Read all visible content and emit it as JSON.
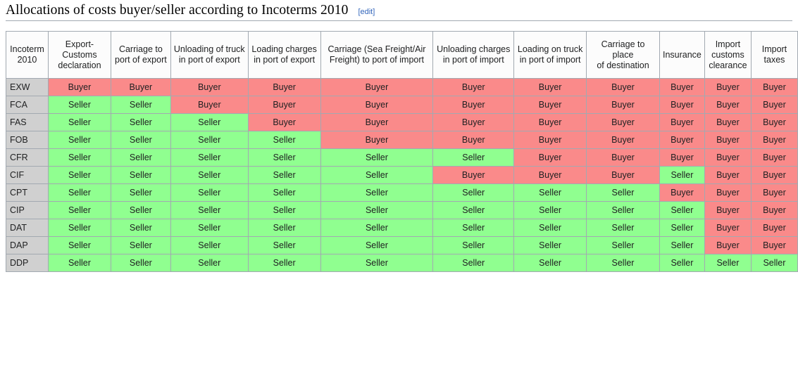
{
  "heading": {
    "title": "Allocations of costs buyer/seller according to Incoterms 2010",
    "edit_label": "[edit]"
  },
  "colors": {
    "buyer_bg": "#fa8a8a",
    "seller_bg": "#90ff90",
    "rowhead_bg": "#d0d0d0",
    "header_bg": "#fcfcfc",
    "border": "#a2a9b1",
    "link": "#3366bb"
  },
  "table": {
    "columns": [
      "Incoterm 2010",
      "Export- Customs declaration",
      "Carriage to port of export",
      "Unloading of truck in port of export",
      "Loading charges in port of export",
      "Carriage (Sea Freight/Air Freight) to port of import",
      "Unloading charges in port of import",
      "Loading on truck in port of import",
      "Carriage to place of destination",
      "Insurance",
      "Import customs clearance",
      "Import taxes"
    ],
    "column_lines": [
      [
        "Incoterm",
        "2010"
      ],
      [
        "Export-",
        "Customs",
        "declaration"
      ],
      [
        "Carriage to",
        "port of export"
      ],
      [
        "Unloading of truck",
        "in port of export"
      ],
      [
        "Loading charges",
        "in port of export"
      ],
      [
        "Carriage (Sea Freight/Air",
        "Freight) to port of import"
      ],
      [
        "Unloading charges",
        "in port of import"
      ],
      [
        "Loading on truck",
        "in port of import"
      ],
      [
        "Carriage to place",
        "of destination"
      ],
      [
        "Insurance"
      ],
      [
        "Import",
        "customs",
        "clearance"
      ],
      [
        "Import",
        "taxes"
      ]
    ],
    "rows": [
      {
        "incoterm": "EXW",
        "values": [
          "Buyer",
          "Buyer",
          "Buyer",
          "Buyer",
          "Buyer",
          "Buyer",
          "Buyer",
          "Buyer",
          "Buyer",
          "Buyer",
          "Buyer"
        ]
      },
      {
        "incoterm": "FCA",
        "values": [
          "Seller",
          "Seller",
          "Buyer",
          "Buyer",
          "Buyer",
          "Buyer",
          "Buyer",
          "Buyer",
          "Buyer",
          "Buyer",
          "Buyer"
        ]
      },
      {
        "incoterm": "FAS",
        "values": [
          "Seller",
          "Seller",
          "Seller",
          "Buyer",
          "Buyer",
          "Buyer",
          "Buyer",
          "Buyer",
          "Buyer",
          "Buyer",
          "Buyer"
        ]
      },
      {
        "incoterm": "FOB",
        "values": [
          "Seller",
          "Seller",
          "Seller",
          "Seller",
          "Buyer",
          "Buyer",
          "Buyer",
          "Buyer",
          "Buyer",
          "Buyer",
          "Buyer"
        ]
      },
      {
        "incoterm": "CFR",
        "values": [
          "Seller",
          "Seller",
          "Seller",
          "Seller",
          "Seller",
          "Seller",
          "Buyer",
          "Buyer",
          "Buyer",
          "Buyer",
          "Buyer"
        ]
      },
      {
        "incoterm": "CIF",
        "values": [
          "Seller",
          "Seller",
          "Seller",
          "Seller",
          "Seller",
          "Buyer",
          "Buyer",
          "Buyer",
          "Seller",
          "Buyer",
          "Buyer"
        ]
      },
      {
        "incoterm": "CPT",
        "values": [
          "Seller",
          "Seller",
          "Seller",
          "Seller",
          "Seller",
          "Seller",
          "Seller",
          "Seller",
          "Buyer",
          "Buyer",
          "Buyer"
        ]
      },
      {
        "incoterm": "CIP",
        "values": [
          "Seller",
          "Seller",
          "Seller",
          "Seller",
          "Seller",
          "Seller",
          "Seller",
          "Seller",
          "Seller",
          "Buyer",
          "Buyer"
        ]
      },
      {
        "incoterm": "DAT",
        "values": [
          "Seller",
          "Seller",
          "Seller",
          "Seller",
          "Seller",
          "Seller",
          "Seller",
          "Seller",
          "Seller",
          "Buyer",
          "Buyer"
        ]
      },
      {
        "incoterm": "DAP",
        "values": [
          "Seller",
          "Seller",
          "Seller",
          "Seller",
          "Seller",
          "Seller",
          "Seller",
          "Seller",
          "Seller",
          "Buyer",
          "Buyer"
        ]
      },
      {
        "incoterm": "DDP",
        "values": [
          "Seller",
          "Seller",
          "Seller",
          "Seller",
          "Seller",
          "Seller",
          "Seller",
          "Seller",
          "Seller",
          "Seller",
          "Seller"
        ]
      }
    ]
  }
}
